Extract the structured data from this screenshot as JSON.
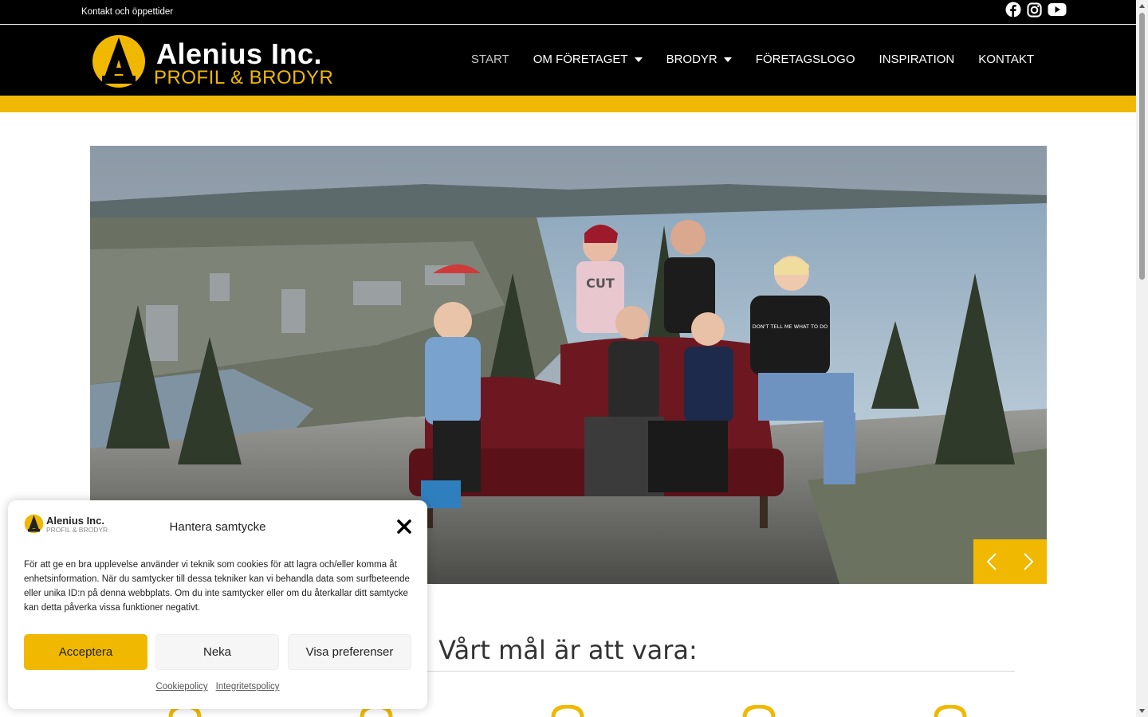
{
  "topbar": {
    "link": "Kontakt och öppettider",
    "social": [
      {
        "icon": "facebook-icon"
      },
      {
        "icon": "instagram-icon"
      },
      {
        "icon": "youtube-icon"
      }
    ]
  },
  "header": {
    "logo_line1": "Alenius Inc.",
    "logo_line2": "PROFIL & BRODYR",
    "nav": [
      {
        "label": "START",
        "active": true
      },
      {
        "label": "OM FÖRETAGET",
        "dropdown": true
      },
      {
        "label": "BRODYR",
        "dropdown": true
      },
      {
        "label": "FÖRETAGSLOGO"
      },
      {
        "label": "INSPIRATION"
      },
      {
        "label": "KONTAKT"
      }
    ]
  },
  "hero": {
    "shirt_text": "CUT",
    "sweater_text": "DON'T TELL ME WHAT TO DO"
  },
  "section": {
    "title": "Vårt mål är att vara:"
  },
  "cookie": {
    "logo_line1": "Alenius Inc.",
    "logo_line2": "PROFIL & BRODYR",
    "title": "Hantera samtycke",
    "text": "För att ge en bra upplevelse använder vi teknik som cookies för att lagra och/eller komma åt enhetsinformation. När du samtycker till dessa tekniker kan vi behandla data som surfbeteende eller unika ID:n på denna webbplats. Om du inte samtycker eller om du återkallar ditt samtycke kan detta påverka vissa funktioner negativt.",
    "accept": "Acceptera",
    "deny": "Neka",
    "prefs": "Visa preferenser",
    "link1": "Cookiepolicy",
    "link2": "Integritetspolicy"
  },
  "colors": {
    "brand_yellow": "#f0b800",
    "header_black": "#000000"
  }
}
